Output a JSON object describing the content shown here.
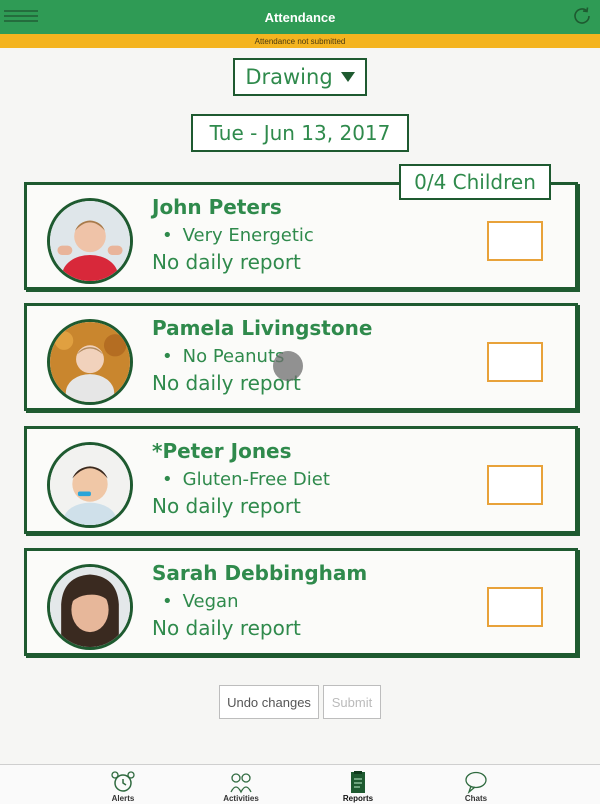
{
  "header": {
    "title": "Attendance",
    "status": "Attendance not submitted"
  },
  "filter": {
    "selected": "Drawing"
  },
  "date": "Tue - Jun 13, 2017",
  "count_label": "0/4 Children",
  "children": [
    {
      "name": "John Peters",
      "note": "Very Energetic",
      "report": "No daily report"
    },
    {
      "name": "Pamela Livingstone",
      "note": "No Peanuts",
      "report": "No daily report"
    },
    {
      "name": "*Peter Jones",
      "note": "Gluten-Free Diet",
      "report": "No daily report"
    },
    {
      "name": "Sarah Debbingham",
      "note": "Vegan",
      "report": "No daily report"
    }
  ],
  "actions": {
    "undo": "Undo changes",
    "submit": "Submit"
  },
  "tabs": [
    {
      "label": "Alerts",
      "icon": "alarm-clock-icon"
    },
    {
      "label": "Activities",
      "icon": "activities-icon"
    },
    {
      "label": "Reports",
      "icon": "clipboard-icon"
    },
    {
      "label": "Chats",
      "icon": "chat-bubble-icon"
    }
  ],
  "colors": {
    "brand": "#2f9b55",
    "warning": "#f4b41f",
    "ink": "#1e5a30",
    "checkbox": "#e8a23a"
  }
}
